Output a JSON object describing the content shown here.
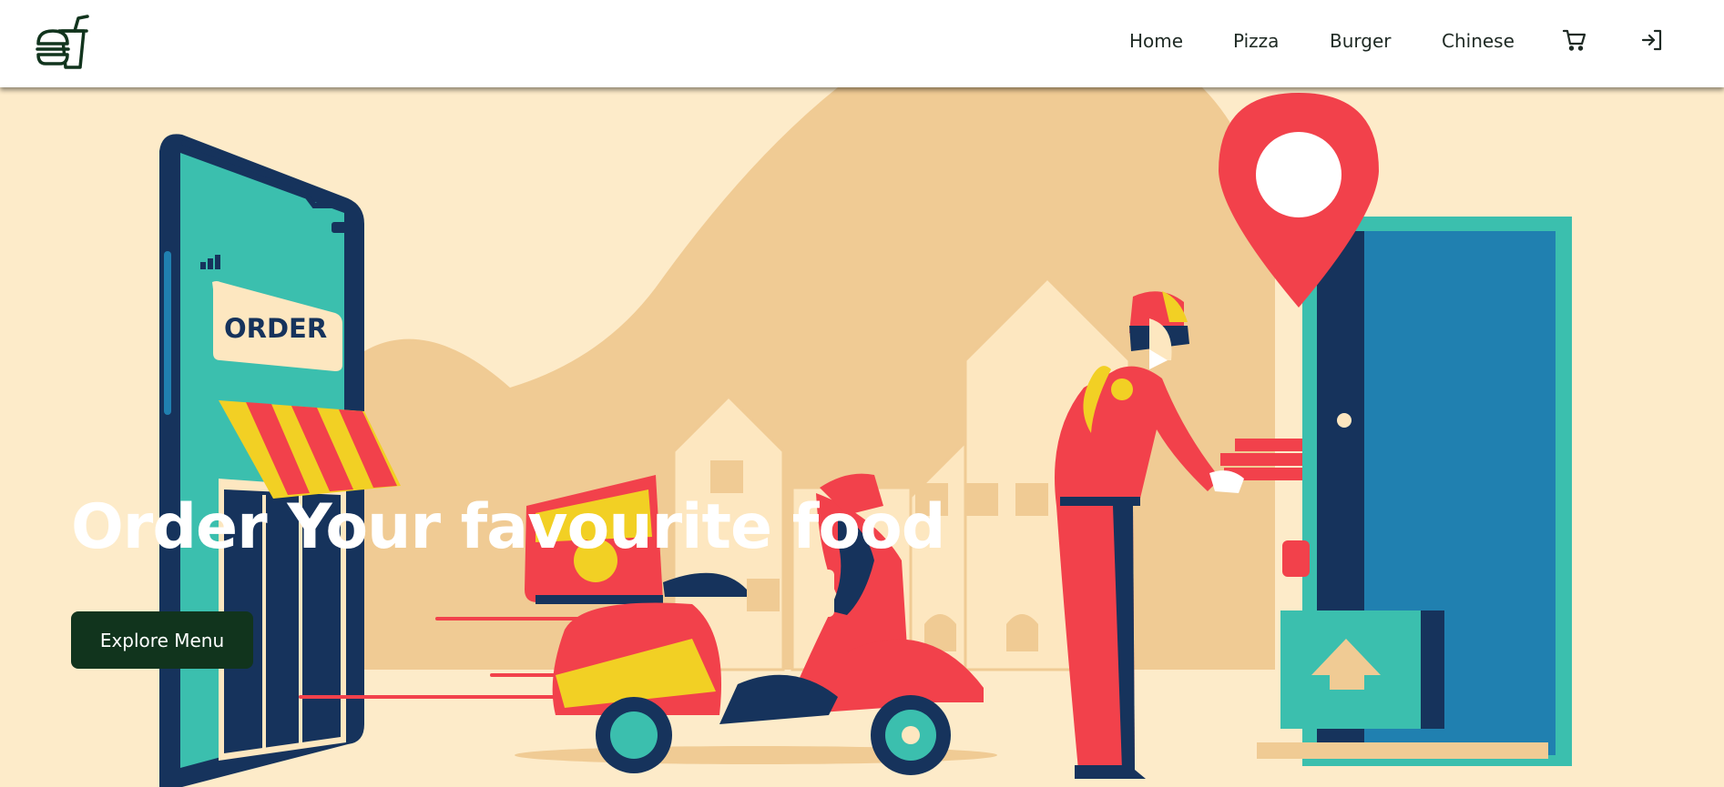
{
  "nav": {
    "logo_icon": "burger-drink-logo-icon",
    "links": [
      "Home",
      "Pizza",
      "Burger",
      "Chinese"
    ],
    "cart_icon": "cart-icon",
    "login_icon": "login-icon"
  },
  "hero": {
    "title": "Order Your favourite food",
    "cta_label": "Explore Menu",
    "phone_sign": "ORDER"
  },
  "colors": {
    "background": "#fdebc9",
    "hill": "#f0cb94",
    "button": "#11341d",
    "red": "#f2414b",
    "teal": "#3bbfae",
    "navy": "#16335c",
    "door_blue": "#2080b0",
    "yellow": "#f2d024"
  }
}
